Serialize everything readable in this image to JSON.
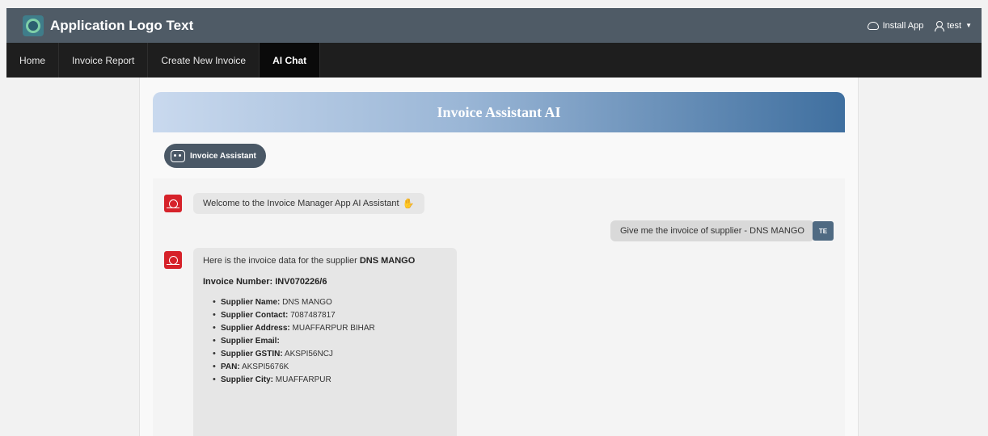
{
  "header": {
    "title": "Application Logo Text",
    "install_label": "Install App",
    "user_label": "test",
    "logo_icon": "app-logo-icon"
  },
  "nav": {
    "tabs": [
      {
        "label": "Home"
      },
      {
        "label": "Invoice Report"
      },
      {
        "label": "Create New Invoice"
      },
      {
        "label": "AI Chat"
      }
    ]
  },
  "banner": {
    "title": "Invoice Assistant AI"
  },
  "assistant_pill": {
    "label": "Invoice Assistant"
  },
  "chat": {
    "welcome": "Welcome to the Invoice Manager App AI Assistant",
    "user_message": "Give me the invoice of supplier - DNS MANGO",
    "user_initials": "TE",
    "reply": {
      "intro": "Here is the invoice data for the supplier",
      "supplier_bold": "DNS MANGO",
      "invoice_number_label": "Invoice Number: INV070226/6",
      "fields": [
        {
          "label": "Supplier Name:",
          "value": "DNS MANGO"
        },
        {
          "label": "Supplier Contact:",
          "value": "7087487817"
        },
        {
          "label": "Supplier Address:",
          "value": "MUAFFARPUR BIHAR"
        },
        {
          "label": "Supplier Email:",
          "value": ""
        },
        {
          "label": "Supplier GSTIN:",
          "value": "AKSPI56NCJ"
        },
        {
          "label": "PAN:",
          "value": "AKSPI5676K"
        },
        {
          "label": "Supplier City:",
          "value": "MUAFFARPUR"
        }
      ]
    }
  },
  "colors": {
    "header_bg": "#4f5b66",
    "nav_bg": "#1e1e1e",
    "bot_avatar": "#d6222a",
    "user_avatar": "#4f6a82"
  }
}
